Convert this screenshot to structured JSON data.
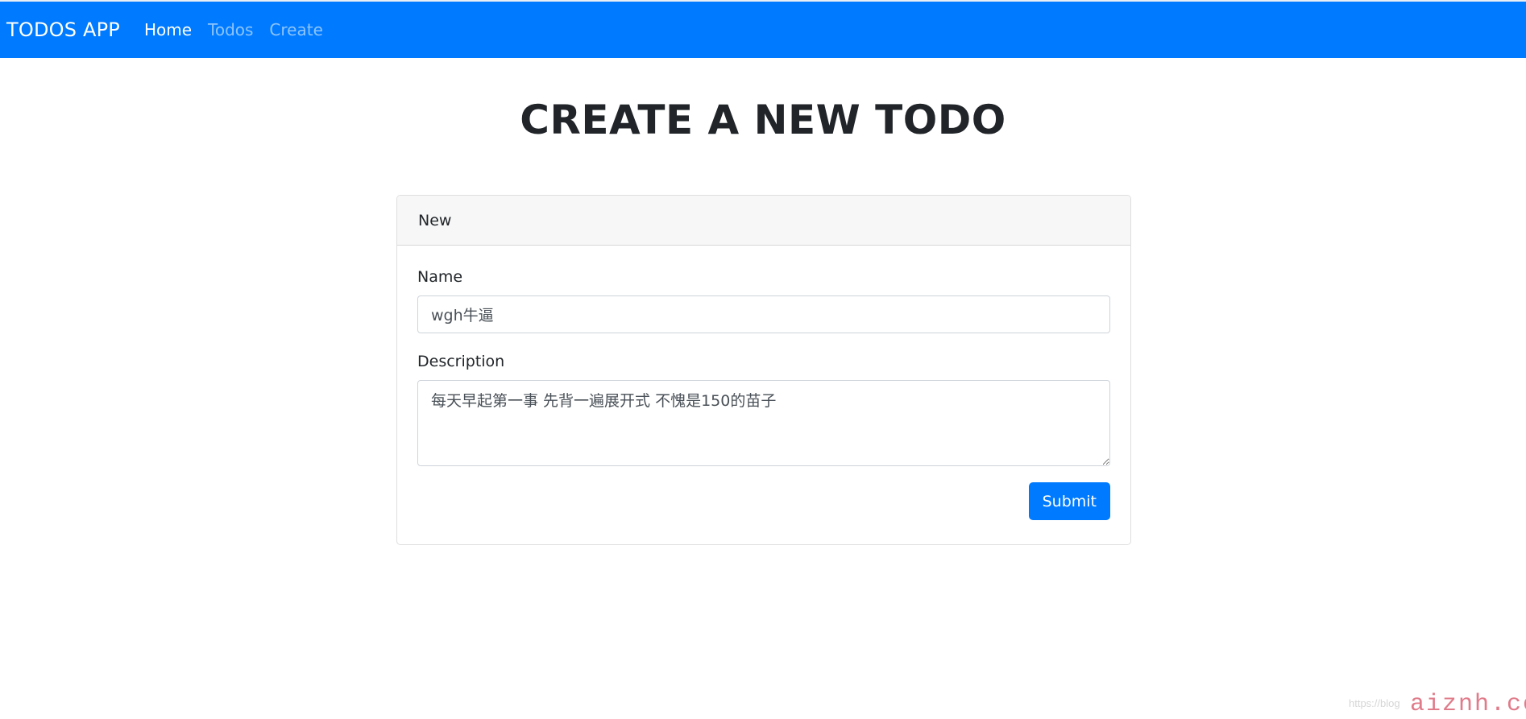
{
  "colors": {
    "primary": "#007bff"
  },
  "navbar": {
    "brand": "TODOS APP",
    "links": [
      {
        "label": "Home",
        "active": true
      },
      {
        "label": "Todos",
        "active": false
      },
      {
        "label": "Create",
        "active": false
      }
    ]
  },
  "page": {
    "title": "CREATE A NEW TODO"
  },
  "card": {
    "header": "New",
    "form": {
      "name": {
        "label": "Name",
        "value": "wgh牛逼"
      },
      "description": {
        "label": "Description",
        "value": "每天早起第一事 先背一遍展开式 不愧是150的苗子"
      },
      "submit_label": "Submit"
    }
  },
  "watermark": {
    "url": "https://blog",
    "logo": "aiznh.com"
  }
}
